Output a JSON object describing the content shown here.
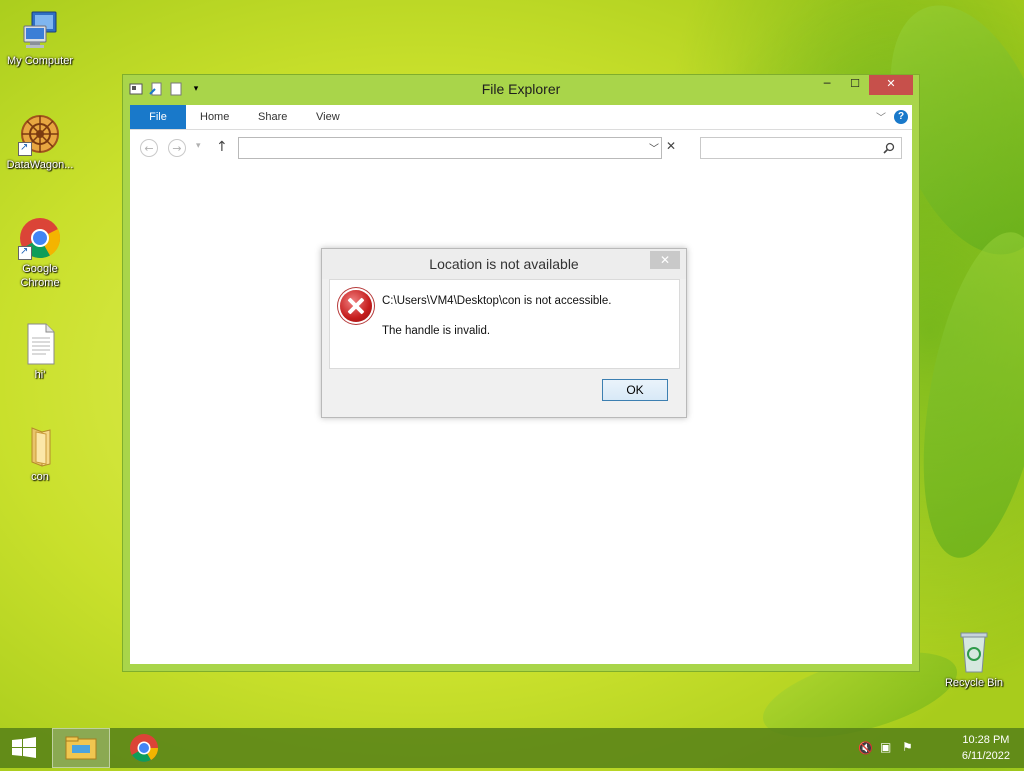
{
  "desktop": {
    "icons": [
      {
        "label": "My Computer",
        "icon": "computer-icon"
      },
      {
        "label": "DataWagon...",
        "icon": "datawagon-icon"
      },
      {
        "label": "Google\nChrome",
        "label_line1": "Google",
        "label_line2": "Chrome",
        "icon": "chrome-icon"
      },
      {
        "label": "hi'",
        "icon": "text-file-icon"
      },
      {
        "label": "con",
        "icon": "folder-icon"
      },
      {
        "label": "Recycle Bin",
        "icon": "recycle-bin-icon"
      }
    ]
  },
  "explorer": {
    "title": "File Explorer",
    "tabs": [
      "File",
      "Home",
      "Share",
      "View"
    ],
    "address_value": "",
    "search_placeholder": "",
    "accent_color": "#1979ca",
    "frame_color": "#a9d54a"
  },
  "dialog": {
    "title": "Location is not available",
    "message": "C:\\Users\\VM4\\Desktop\\con is not accessible.",
    "detail": "The handle is invalid.",
    "ok_label": "OK",
    "icon": "error-icon"
  },
  "taskbar": {
    "items": [
      "start-icon",
      "file-explorer-icon",
      "chrome-icon"
    ],
    "tray_icons": [
      "volume-muted-icon",
      "network-icon",
      "action-center-icon"
    ],
    "time": "10:28 PM",
    "date": "6/11/2022"
  }
}
